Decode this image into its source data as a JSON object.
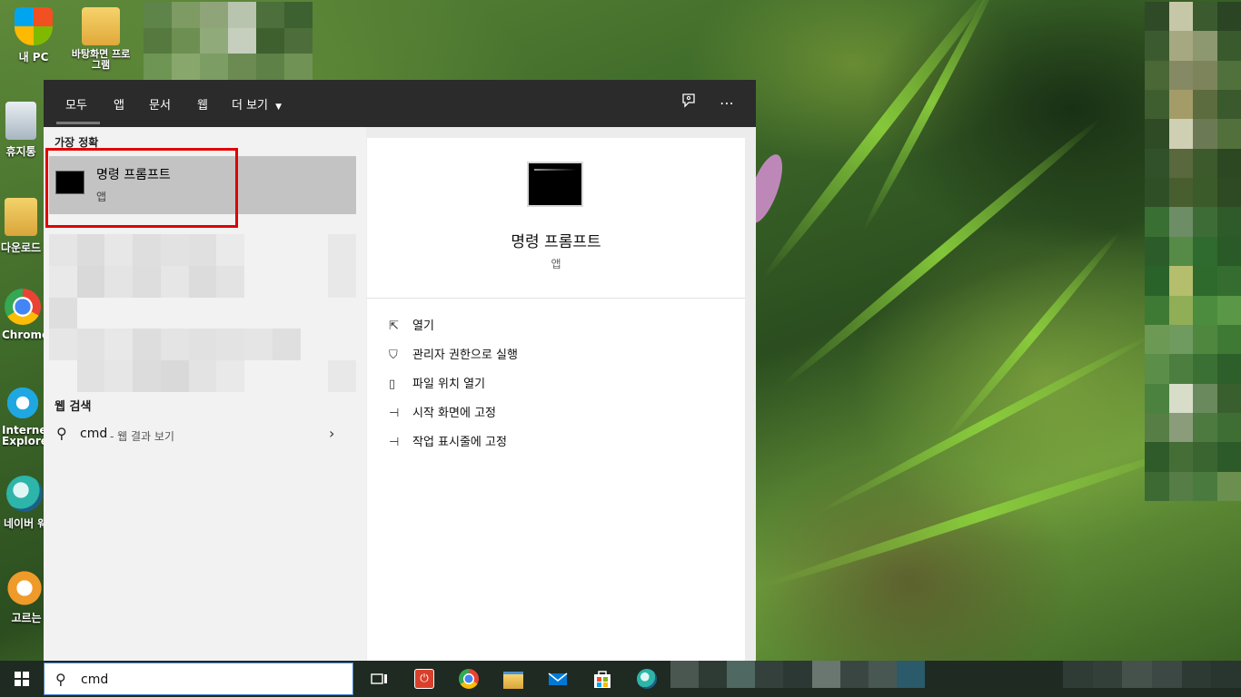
{
  "desktop": {
    "icons": [
      {
        "label": "내 PC",
        "icon": "pc-shield-icon"
      },
      {
        "label": "바탕화면 프로그램",
        "icon": "folder-shortcut-icon"
      },
      {
        "label": "휴지통",
        "icon": "recycle-bin-icon"
      },
      {
        "label": "다운로드",
        "icon": "folder-icon"
      },
      {
        "label": "Chrome",
        "icon": "chrome-icon"
      },
      {
        "label": "Internet Explorer",
        "icon": "ie-icon"
      },
      {
        "label": "네이버 웨일",
        "icon": "whale-icon"
      },
      {
        "label": "고르는",
        "icon": "app-shortcut-icon"
      }
    ]
  },
  "search_panel": {
    "tabs": [
      "모두",
      "앱",
      "문서",
      "웹",
      "더 보기"
    ],
    "best_match_header": "가장 정확",
    "best_match": {
      "title": "명령 프롬프트",
      "subtitle": "앱"
    },
    "web_search_header": "웹 검색",
    "web_result": {
      "query": "cmd",
      "suffix": "- 웹 결과 보기"
    },
    "preview": {
      "title": "명령 프롬프트",
      "subtitle": "앱",
      "actions": [
        {
          "label": "열기",
          "icon": "open-icon"
        },
        {
          "label": "관리자 권한으로 실행",
          "icon": "shield-icon"
        },
        {
          "label": "파일 위치 열기",
          "icon": "file-location-icon"
        },
        {
          "label": "시작 화면에 고정",
          "icon": "pin-icon"
        },
        {
          "label": "작업 표시줄에 고정",
          "icon": "pin-icon"
        }
      ]
    }
  },
  "taskbar": {
    "search_value": "cmd",
    "apps": [
      "task-view-icon",
      "power-app-icon",
      "chrome-icon",
      "file-explorer-icon",
      "mail-icon",
      "store-icon",
      "whale-icon"
    ]
  },
  "colors": {
    "highlight_border": "#e00000",
    "panel_dark": "#2b2b2b",
    "selected_row": "#c3c3c3"
  }
}
